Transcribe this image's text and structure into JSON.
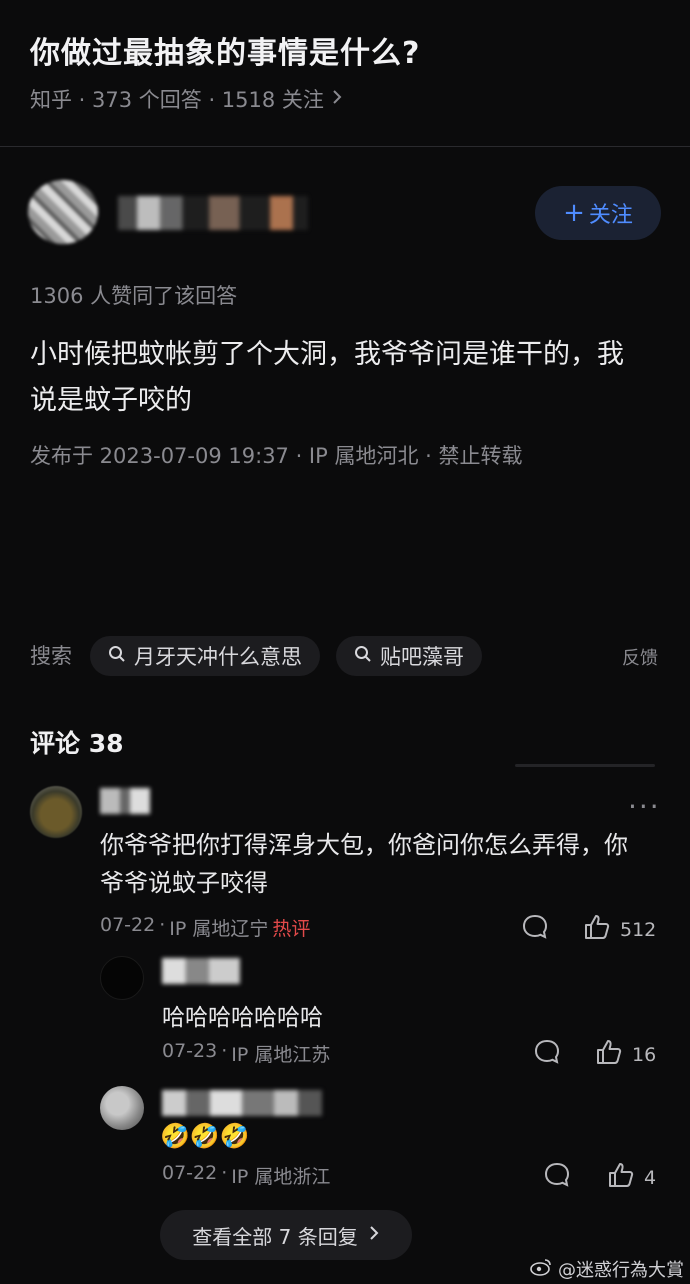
{
  "question": {
    "title": "你做过最抽象的事情是什么?",
    "meta": "知乎 · 373 个回答 · 1518 关注"
  },
  "answer": {
    "follow_label": "关注",
    "likes_text": "1306 人赞同了该回答",
    "content": "小时候把蚊帐剪了个大洞，我爷爷问是谁干的，我说是蚊子咬的",
    "publish_info": "发布于 2023-07-09 19:37 · IP 属地河北 · 禁止转载"
  },
  "search": {
    "label": "搜索",
    "chips": [
      "月牙天冲什么意思",
      "贴吧藻哥"
    ],
    "feedback": "反馈"
  },
  "comments": {
    "title": "评论 38",
    "items": [
      {
        "text": "你爷爷把你打得浑身大包，你爸问你怎么弄得，你爷爷说蚊子咬得",
        "date": "07-22",
        "location": "IP 属地辽宁",
        "tag": "热评",
        "likes": "512"
      }
    ],
    "replies": [
      {
        "text": "哈哈哈哈哈哈哈",
        "date": "07-23",
        "location": "IP 属地江苏",
        "likes": "16"
      },
      {
        "text": "🤣🤣🤣",
        "date": "07-22",
        "location": "IP 属地浙江",
        "likes": "4"
      }
    ],
    "view_all": "查看全部 7 条回复"
  },
  "watermark": "@迷惑行為大賞",
  "icons": {
    "chevron": "chevron-right-icon",
    "comment": "comment-bubble-icon",
    "like": "thumbs-up-icon",
    "search": "search-icon",
    "more": "more-dots-icon",
    "weibo": "weibo-logo-icon"
  },
  "colors": {
    "accent": "#4f8cff",
    "hot": "#e24a4a",
    "background": "#0b0b0c"
  }
}
